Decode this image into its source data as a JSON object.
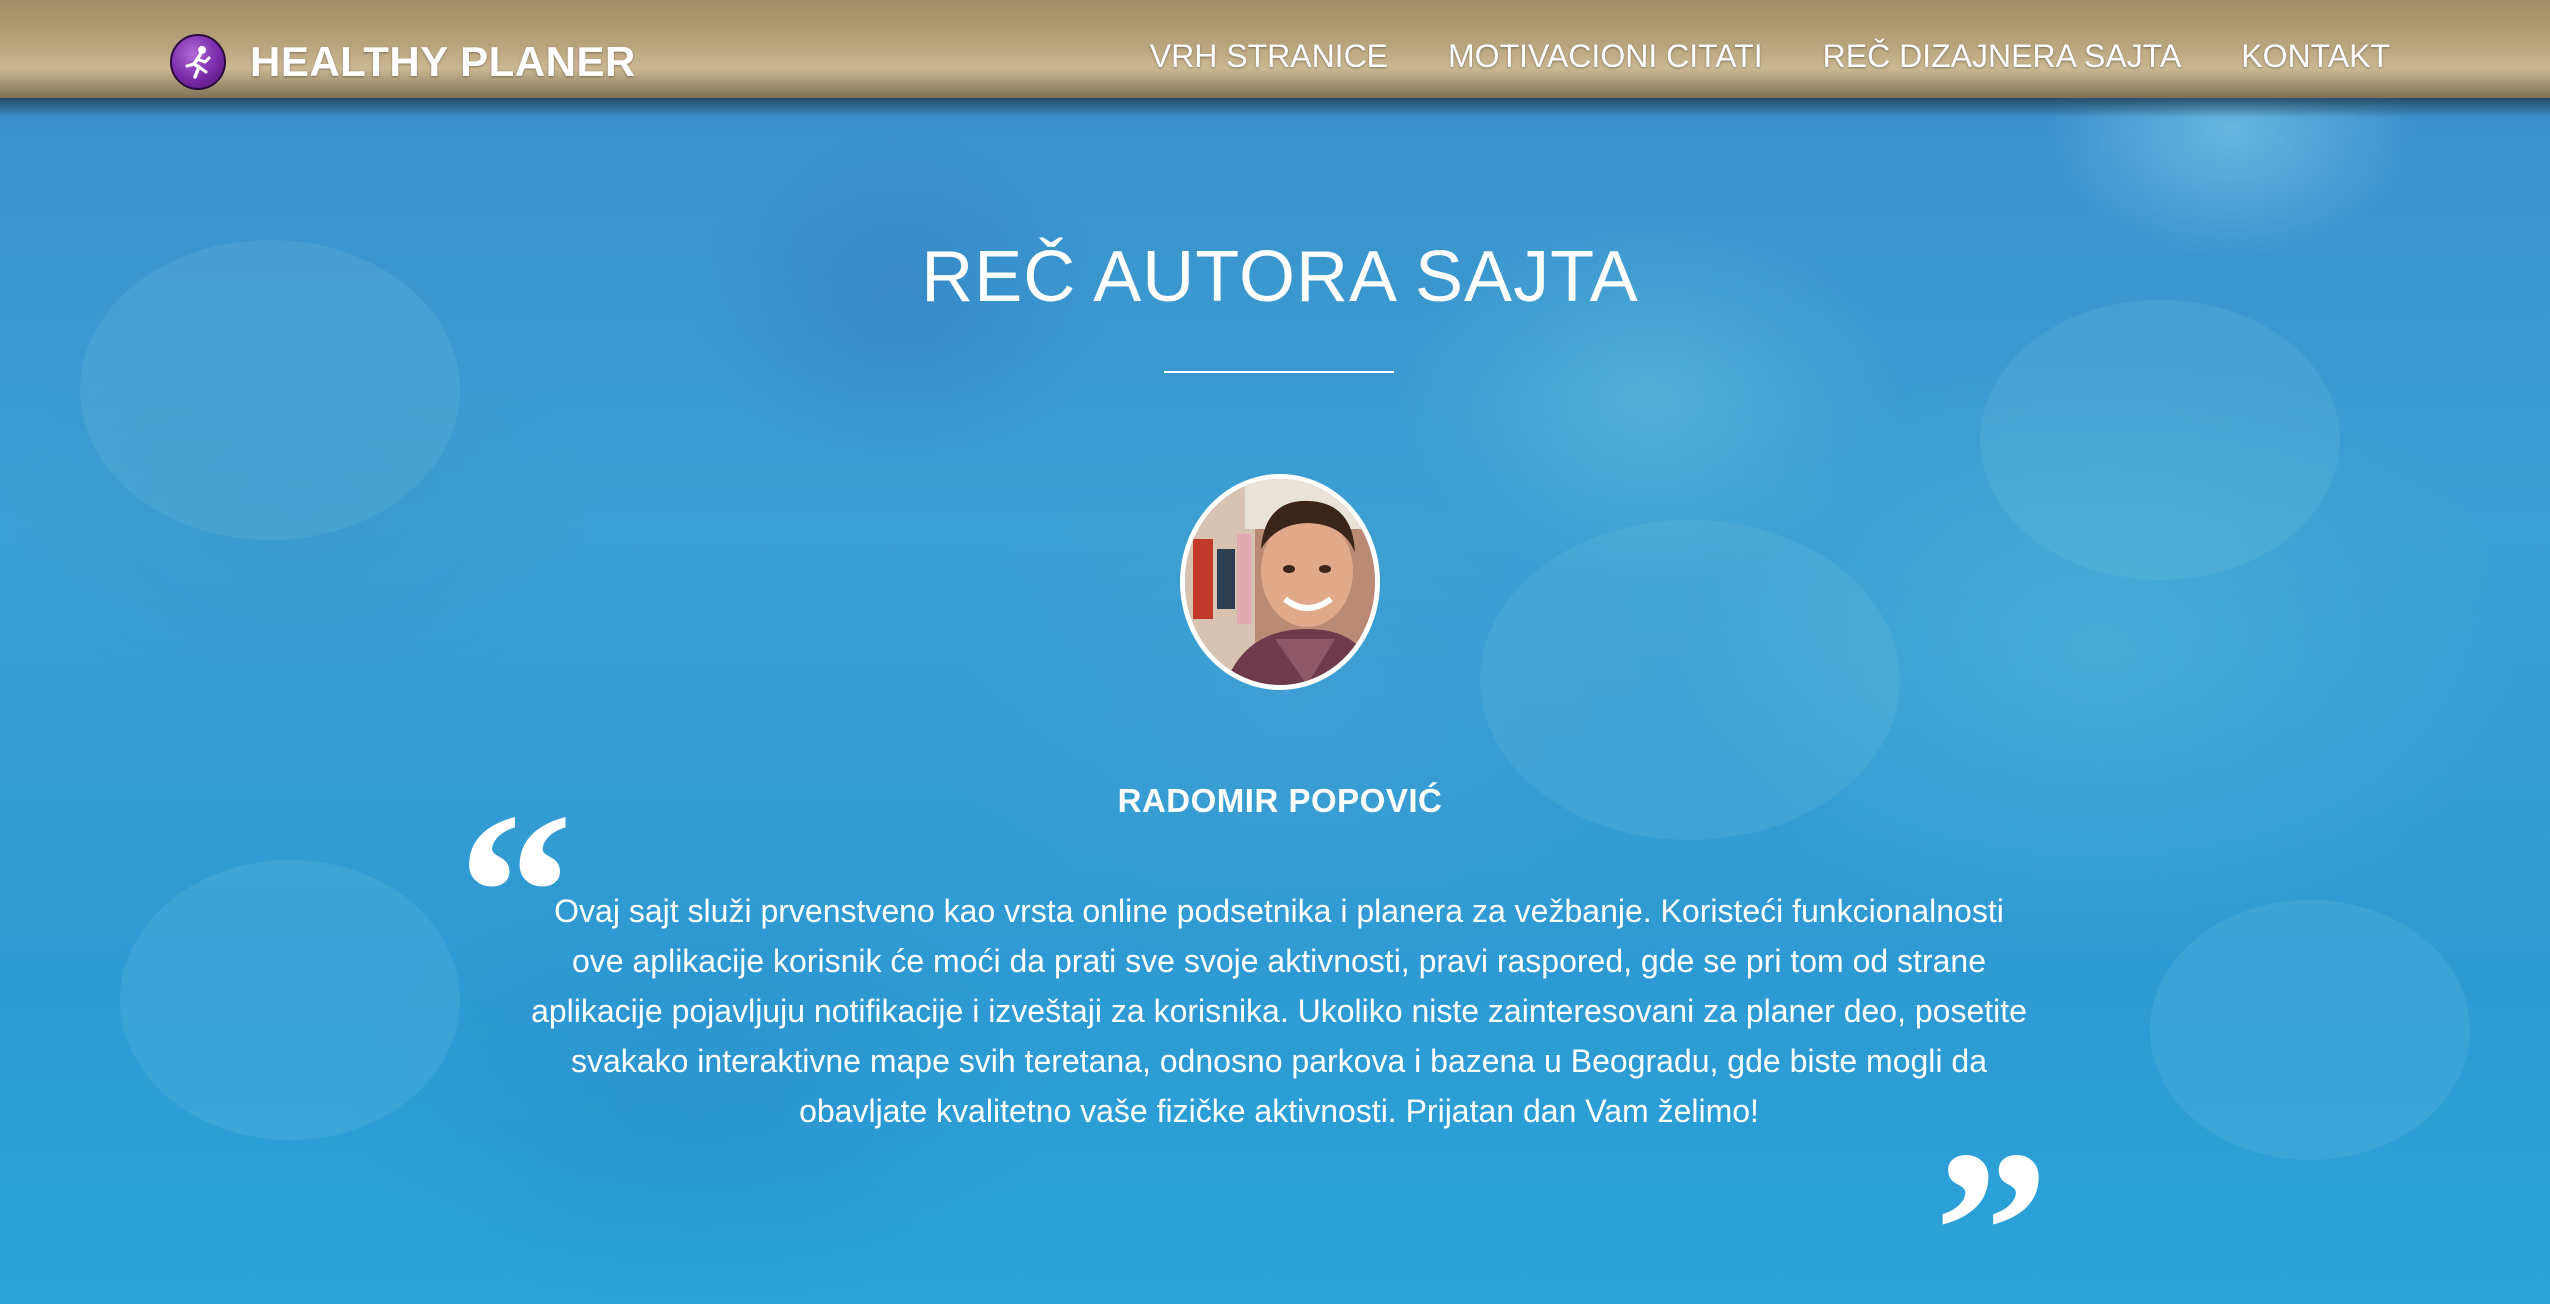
{
  "navbar": {
    "brand_name": "HEALTHY PLANER",
    "brand_icon": "runner-icon",
    "links": [
      {
        "label": "VRH STRANICE"
      },
      {
        "label": "MOTIVACIONI CITATI"
      },
      {
        "label": "REČ DIZAJNERA SAJTA"
      },
      {
        "label": "KONTAKT"
      }
    ]
  },
  "section": {
    "title": "REČ AUTORA SAJTA",
    "author_name": "RADOMIR POPOVIĆ",
    "quote": "Ovaj sajt služi prvenstveno kao vrsta online podsetnika i planera za vežbanje. Koristeći funkcionalnosti ove aplikacije korisnik će moći da prati sve svoje aktivnosti, pravi raspored, gde se pri tom od strane aplikacije pojavljuju notifikacije i izveštaji za korisnika. Ukoliko niste zainteresovani za planer deo, posetite svakako interaktivne mape svih teretana, odnosno parkova i bazena u Beogradu, gde biste mogli da obavljate kvalitetno vaše fizičke aktivnosti. Prijatan dan Vam želimo!",
    "open_quote_mark": "“",
    "close_quote_mark": "”"
  },
  "colors": {
    "background_tint": "#2f9ad0",
    "navbar": "#b8a37c",
    "brand_logo": "#7a2aa8",
    "text": "#ffffff"
  }
}
